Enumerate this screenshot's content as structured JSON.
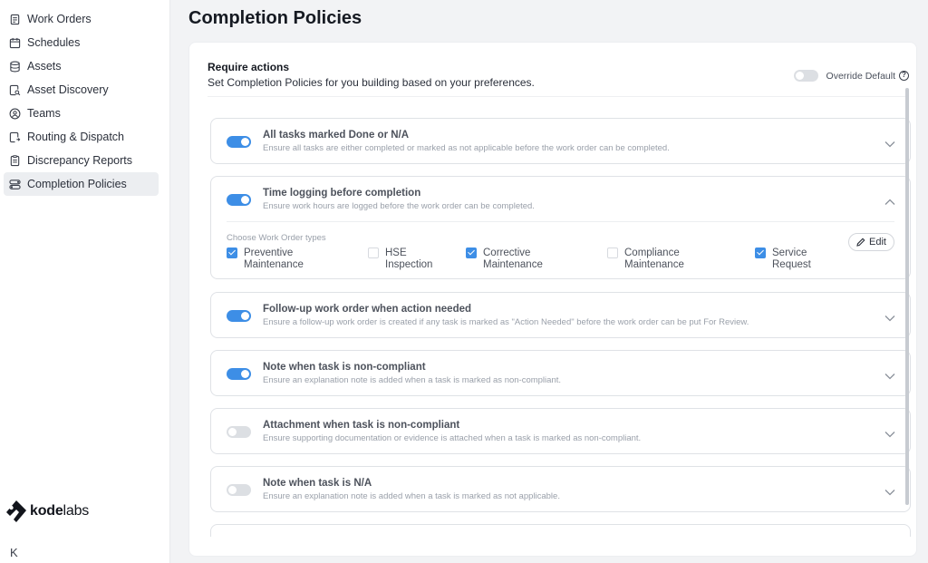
{
  "sidebar": {
    "items": [
      {
        "label": "Work Orders",
        "icon": "clipboard-icon",
        "active": false
      },
      {
        "label": "Schedules",
        "icon": "calendar-icon",
        "active": false
      },
      {
        "label": "Assets",
        "icon": "database-icon",
        "active": false
      },
      {
        "label": "Asset Discovery",
        "icon": "search-doc-icon",
        "active": false
      },
      {
        "label": "Teams",
        "icon": "people-icon",
        "active": false
      },
      {
        "label": "Routing & Dispatch",
        "icon": "routing-icon",
        "active": false
      },
      {
        "label": "Discrepancy Reports",
        "icon": "report-icon",
        "active": false
      },
      {
        "label": "Completion Policies",
        "icon": "toggles-icon",
        "active": true
      }
    ],
    "logo": {
      "part1": "kode",
      "part2": "labs"
    },
    "collapse_label": "K"
  },
  "page": {
    "title": "Completion Policies"
  },
  "card": {
    "title": "Require actions",
    "subtitle": "Set Completion Policies for you building based on your preferences.",
    "override_label": "Override Default",
    "help_symbol": "?"
  },
  "policies": [
    {
      "title": "All tasks marked Done or N/A",
      "description": "Ensure all tasks are either completed or marked as not applicable before the work order can be completed.",
      "enabled": true,
      "expanded": false
    },
    {
      "title": "Time logging before completion",
      "description": "Ensure work hours are logged before the work order can be completed.",
      "enabled": true,
      "expanded": true
    },
    {
      "title": "Follow-up work order when action needed",
      "description": "Ensure a follow-up work order is created if any task is marked as \"Action Needed\" before the work order can be put For Review.",
      "enabled": true,
      "expanded": false
    },
    {
      "title": "Note when task is non-compliant",
      "description": "Ensure an explanation note is added when a task is marked as non-compliant.",
      "enabled": true,
      "expanded": false
    },
    {
      "title": "Attachment when task is non-compliant",
      "description": "Ensure supporting documentation or evidence is attached when a task is marked as non-compliant.",
      "enabled": false,
      "expanded": false
    },
    {
      "title": "Note when task is N/A",
      "description": "Ensure an explanation note is added when a task is marked as not applicable.",
      "enabled": false,
      "expanded": false
    }
  ],
  "time_logging": {
    "choose_label": "Choose Work Order types",
    "edit_label": "Edit",
    "types": [
      {
        "line1": "Preventive",
        "line2": "Maintenance",
        "checked": true
      },
      {
        "line1": "HSE",
        "line2": "Inspection",
        "checked": false
      },
      {
        "line1": "Corrective",
        "line2": "Maintenance",
        "checked": true
      },
      {
        "line1": "Compliance",
        "line2": "Maintenance",
        "checked": false
      },
      {
        "line1": "Service",
        "line2": "Request",
        "checked": true
      }
    ]
  },
  "colors": {
    "accent": "#3d8ee6",
    "toggle_off": "#dcdfe3",
    "active_nav": "#eceef1"
  }
}
